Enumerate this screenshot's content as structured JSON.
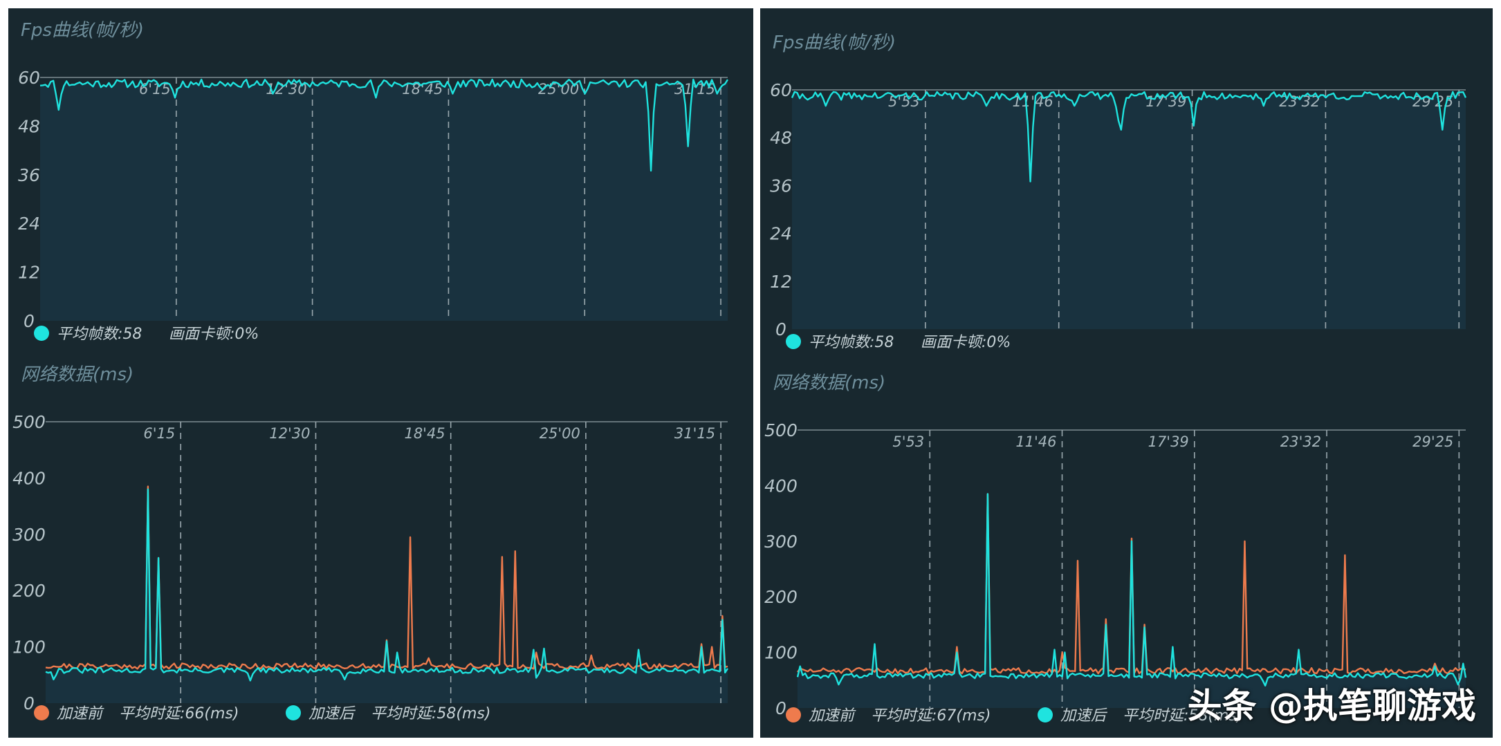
{
  "colors": {
    "background": "#18282f",
    "plot_area": "#19323f",
    "fps_line": "#1fe3df",
    "before_line": "#ee7b4d",
    "after_line": "#1fe3df",
    "grid_dash": "#9aa8ae",
    "title": "#6f8f9c"
  },
  "watermark": "头条 @执笔聊游戏",
  "chart_data": [
    {
      "type": "line",
      "panel": "left",
      "title": "Fps曲线(帧/秒)",
      "ylim": [
        0,
        60
      ],
      "yticks": [
        0,
        12,
        24,
        36,
        48,
        60
      ],
      "xlim": [
        0,
        1.0
      ],
      "xticks": [
        {
          "x": 0.198,
          "label": "6'15"
        },
        {
          "x": 0.396,
          "label": "12'30"
        },
        {
          "x": 0.594,
          "label": "18'45"
        },
        {
          "x": 0.792,
          "label": "25'00"
        },
        {
          "x": 0.99,
          "label": "31'15"
        }
      ],
      "legend": [
        {
          "color": "#1fe3df",
          "text": "平均帧数:58"
        },
        {
          "text": "画面卡顿:0%"
        }
      ],
      "series": [
        {
          "color": "#1fe3df",
          "base": 58.5,
          "noise": 1.0,
          "seed": 11,
          "dips": [
            [
              0.028,
              52
            ],
            [
              0.196,
              55
            ],
            [
              0.337,
              56
            ],
            [
              0.49,
              55
            ],
            [
              0.6,
              56
            ],
            [
              0.73,
              57
            ],
            [
              0.792,
              56
            ],
            [
              0.887,
              37
            ],
            [
              0.942,
              43
            ],
            [
              0.985,
              56
            ]
          ]
        }
      ]
    },
    {
      "type": "line",
      "panel": "left",
      "title": "网络数据(ms)",
      "ylim": [
        0,
        500
      ],
      "yticks": [
        0,
        100,
        200,
        300,
        400,
        500
      ],
      "xlim": [
        0,
        1.0
      ],
      "xticks": [
        {
          "x": 0.198,
          "label": "6'15"
        },
        {
          "x": 0.396,
          "label": "12'30"
        },
        {
          "x": 0.594,
          "label": "18'45"
        },
        {
          "x": 0.792,
          "label": "25'00"
        },
        {
          "x": 0.99,
          "label": "31'15"
        }
      ],
      "legend": [
        {
          "color": "#ee7b4d",
          "text": "加速前"
        },
        {
          "text": "平均时延:66(ms)"
        },
        {
          "color": "#1fe3df",
          "text": "加速后"
        },
        {
          "text": "平均时延:58(ms)"
        }
      ],
      "series": [
        {
          "name": "加速前",
          "color": "#ee7b4d",
          "base": 66,
          "noise": 5,
          "seed": 21,
          "dips": [],
          "spikes": [
            [
              0.15,
              385
            ],
            [
              0.165,
              258
            ],
            [
              0.5,
              112
            ],
            [
              0.535,
              295
            ],
            [
              0.56,
              80
            ],
            [
              0.67,
              260
            ],
            [
              0.688,
              270
            ],
            [
              0.72,
              90
            ],
            [
              0.8,
              85
            ],
            [
              0.96,
              105
            ],
            [
              0.975,
              100
            ],
            [
              0.994,
              155
            ]
          ]
        },
        {
          "name": "加速后",
          "color": "#1fe3df",
          "base": 58,
          "noise": 5,
          "seed": 31,
          "dips": [
            [
              0.01,
              42
            ],
            [
              0.3,
              40
            ],
            [
              0.44,
              42
            ],
            [
              0.72,
              45
            ]
          ],
          "spikes": [
            [
              0.006,
              55
            ],
            [
              0.15,
              380
            ],
            [
              0.165,
              258
            ],
            [
              0.5,
              110
            ],
            [
              0.515,
              90
            ],
            [
              0.715,
              95
            ],
            [
              0.73,
              97
            ],
            [
              0.87,
              95
            ],
            [
              0.96,
              100
            ],
            [
              0.994,
              148
            ]
          ]
        }
      ]
    },
    {
      "type": "line",
      "panel": "right",
      "title": "Fps曲线(帧/秒)",
      "ylim": [
        0,
        60
      ],
      "yticks": [
        0,
        12,
        24,
        36,
        48,
        60
      ],
      "xlim": [
        0,
        1.0
      ],
      "xticks": [
        {
          "x": 0.198,
          "label": "5'53"
        },
        {
          "x": 0.396,
          "label": "11'46"
        },
        {
          "x": 0.594,
          "label": "17'39"
        },
        {
          "x": 0.792,
          "label": "23'32"
        },
        {
          "x": 0.99,
          "label": "29'25"
        }
      ],
      "legend": [
        {
          "color": "#1fe3df",
          "text": "平均帧数:58"
        },
        {
          "text": "画面卡顿:0%"
        }
      ],
      "series": [
        {
          "color": "#1fe3df",
          "base": 58.5,
          "noise": 1.0,
          "seed": 41,
          "dips": [
            [
              0.05,
              56
            ],
            [
              0.29,
              56
            ],
            [
              0.355,
              37
            ],
            [
              0.42,
              56
            ],
            [
              0.485,
              52
            ],
            [
              0.49,
              50
            ],
            [
              0.595,
              51
            ],
            [
              0.7,
              56
            ],
            [
              0.965,
              50
            ]
          ]
        }
      ]
    },
    {
      "type": "line",
      "panel": "right",
      "title": "网络数据(ms)",
      "ylim": [
        0,
        500
      ],
      "yticks": [
        0,
        100,
        200,
        300,
        400,
        500
      ],
      "xlim": [
        0,
        1.0
      ],
      "xticks": [
        {
          "x": 0.198,
          "label": "5'53"
        },
        {
          "x": 0.396,
          "label": "11'46"
        },
        {
          "x": 0.594,
          "label": "17'39"
        },
        {
          "x": 0.792,
          "label": "23'32"
        },
        {
          "x": 0.99,
          "label": "29'25"
        }
      ],
      "legend": [
        {
          "color": "#ee7b4d",
          "text": "加速前"
        },
        {
          "text": "平均时延:67(ms)"
        },
        {
          "color": "#1fe3df",
          "text": "加速后"
        },
        {
          "text": "平均时延:58(ms)"
        }
      ],
      "series": [
        {
          "name": "加速前",
          "color": "#ee7b4d",
          "base": 67,
          "noise": 5,
          "seed": 51,
          "dips": [],
          "spikes": [
            [
              0.24,
              110
            ],
            [
              0.285,
              385
            ],
            [
              0.395,
              100
            ],
            [
              0.42,
              265
            ],
            [
              0.46,
              160
            ],
            [
              0.5,
              305
            ],
            [
              0.52,
              150
            ],
            [
              0.67,
              300
            ],
            [
              0.82,
              275
            ],
            [
              0.955,
              80
            ]
          ]
        },
        {
          "name": "加速后",
          "color": "#1fe3df",
          "base": 58,
          "noise": 5,
          "seed": 61,
          "dips": [
            [
              0.06,
              42
            ],
            [
              0.7,
              40
            ],
            [
              0.99,
              42
            ]
          ],
          "spikes": [
            [
              0.002,
              75
            ],
            [
              0.115,
              115
            ],
            [
              0.24,
              100
            ],
            [
              0.285,
              385
            ],
            [
              0.385,
              105
            ],
            [
              0.4,
              100
            ],
            [
              0.46,
              150
            ],
            [
              0.5,
              300
            ],
            [
              0.52,
              145
            ],
            [
              0.56,
              110
            ],
            [
              0.75,
              105
            ],
            [
              0.955,
              75
            ],
            [
              0.995,
              80
            ]
          ]
        }
      ]
    }
  ]
}
